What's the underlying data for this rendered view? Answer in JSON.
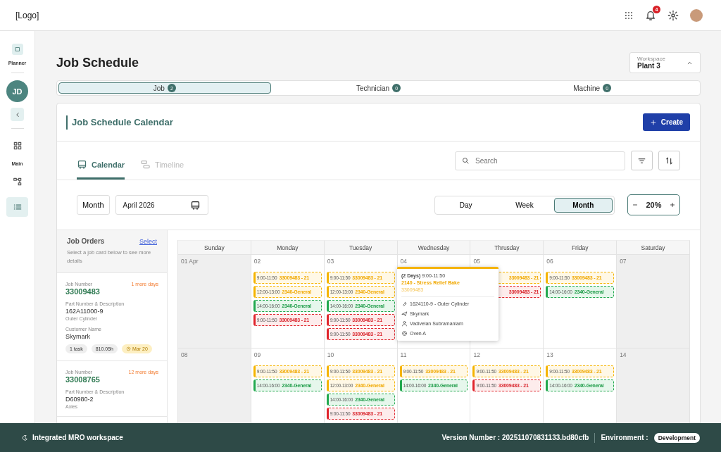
{
  "header": {
    "logo": "[Logo]",
    "notification_count": "4"
  },
  "sidebar": {
    "app_label": "Planner",
    "user_initials": "JD",
    "groups": [
      {
        "items": [
          {
            "kind": "dashboard",
            "selected": false
          }
        ]
      },
      {
        "label": "Main",
        "items": [
          {
            "kind": "hierarchy",
            "selected": false
          },
          {
            "kind": "list",
            "selected": true
          }
        ]
      }
    ]
  },
  "page": {
    "title": "Job Schedule",
    "workspace": {
      "label": "Workspace",
      "value": "Plant 3"
    },
    "view_tabs": [
      {
        "label": "Job",
        "count": "2",
        "selected": true
      },
      {
        "label": "Technician",
        "count": "0",
        "selected": false
      },
      {
        "label": "Machine",
        "count": "0",
        "selected": false
      }
    ]
  },
  "calendar_panel": {
    "title": "Job Schedule Calendar",
    "create_button": "Create",
    "mode_tabs": [
      {
        "label": "Calendar",
        "kind": "calendar",
        "selected": true
      },
      {
        "label": "Timeline",
        "kind": "timeline",
        "selected": false
      }
    ],
    "search": {
      "placeholder": "Search"
    },
    "period_type": "Month",
    "date_value": "April 2026",
    "range_tabs": [
      {
        "label": "Day",
        "selected": false
      },
      {
        "label": "Week",
        "selected": false
      },
      {
        "label": "Month",
        "selected": true
      }
    ],
    "zoom": "20%"
  },
  "job_orders": {
    "title": "Job Orders",
    "select_link": "Select",
    "hint": "Select a job card below to see more details",
    "cards": [
      {
        "job_number_label": "Job Number",
        "job_number": "33009483",
        "due": "1 more days",
        "part_label": "Part Number & Description",
        "part_number": "162A11000-9",
        "description": "Outer Cylinder",
        "customer_label": "Customer Name",
        "customer": "Skymark",
        "tasks": "1 task",
        "hours": "810.05h",
        "date": "Mar 20"
      },
      {
        "job_number_label": "Job Number",
        "job_number": "33008765",
        "due": "12 more days",
        "part_label": "Part Number & Description",
        "part_number": "D60980-2",
        "description": "Axles"
      }
    ]
  },
  "calendar": {
    "weekdays": [
      "Sunday",
      "Monday",
      "Tuesday",
      "Wednesday",
      "Thrusday",
      "Friday",
      "Saturday"
    ],
    "weeks": [
      {
        "days": [
          {
            "date": "01 Apr",
            "weekend": true
          },
          {
            "date": "02",
            "weekend": false,
            "events": [
              {
                "time": "9:00-11:50",
                "title": "33009483 - 21",
                "kind": "pending"
              },
              {
                "time": "12:00-13:00",
                "title": "2340-General",
                "kind": "pending"
              },
              {
                "time": "14:00-16:00",
                "title": "2340-General",
                "kind": "done"
              },
              {
                "time": "9:00-11:50",
                "title": "33009483 - 21",
                "kind": "late"
              }
            ]
          },
          {
            "date": "03",
            "weekend": false,
            "events": [
              {
                "time": "9:00-11:50",
                "title": "33009483 - 21",
                "kind": "pending"
              },
              {
                "time": "12:00-13:00",
                "title": "2340-General",
                "kind": "pending"
              },
              {
                "time": "14:00-16:00",
                "title": "2340-General",
                "kind": "done"
              },
              {
                "time": "9:00-11:50",
                "title": "33009483 - 21",
                "kind": "late"
              },
              {
                "time": "9:00-11:50",
                "title": "33009483 - 21",
                "kind": "late"
              }
            ]
          },
          {
            "date": "04",
            "weekend": false
          },
          {
            "date": "05",
            "weekend": false,
            "events": [
              {
                "title": "33009483 - 21",
                "kind": "pending"
              },
              {
                "title": "33009483 - 21",
                "kind": "late"
              }
            ]
          },
          {
            "date": "06",
            "weekend": false,
            "events": [
              {
                "time": "9:00-11:50",
                "title": "33009483 - 21",
                "kind": "pending"
              },
              {
                "time": "14:00-16:00",
                "title": "2340-General",
                "kind": "done"
              }
            ]
          },
          {
            "date": "07",
            "weekend": true
          }
        ]
      },
      {
        "days": [
          {
            "date": "08",
            "weekend": true
          },
          {
            "date": "09",
            "weekend": false,
            "events": [
              {
                "time": "9:00-11:50",
                "title": "33009483 - 21",
                "kind": "pending"
              },
              {
                "time": "14:00-16:00",
                "title": "2340-General",
                "kind": "done"
              }
            ]
          },
          {
            "date": "10",
            "weekend": false,
            "events": [
              {
                "time": "9:00-11:50",
                "title": "33009483 - 21",
                "kind": "pending"
              },
              {
                "time": "12:00-13:00",
                "title": "2340-General",
                "kind": "pending"
              },
              {
                "time": "14:00-16:00",
                "title": "2340-General",
                "kind": "done"
              },
              {
                "time": "9:00-11:50",
                "title": "33009483 - 21",
                "kind": "late"
              }
            ]
          },
          {
            "date": "11",
            "weekend": false,
            "events": [
              {
                "time": "9:00-11:50",
                "title": "33009483 - 21",
                "kind": "pending"
              },
              {
                "time": "14:00-16:00",
                "title": "2340-General",
                "kind": "done"
              }
            ]
          },
          {
            "date": "12",
            "weekend": false,
            "events": [
              {
                "time": "9:00-11:50",
                "title": "33009483 - 21",
                "kind": "pending"
              },
              {
                "time": "9:00-11:50",
                "title": "33009483 - 21",
                "kind": "late"
              }
            ]
          },
          {
            "date": "13",
            "weekend": false,
            "events": [
              {
                "time": "9:00-11:50",
                "title": "33009483 - 21",
                "kind": "pending"
              },
              {
                "time": "14:00-16:00",
                "title": "2340-General",
                "kind": "done"
              }
            ]
          },
          {
            "date": "14",
            "weekend": true
          }
        ]
      }
    ],
    "popup": {
      "duration": "(2 Days)",
      "time": "9:00-11:50",
      "title": "2140 - Stress Relief Bake",
      "job": "33009483",
      "kind": "pending",
      "details": [
        {
          "kind": "part",
          "text": "1624110-9 - Outer Cylinder"
        },
        {
          "kind": "customer",
          "text": "Skymark"
        },
        {
          "kind": "technician",
          "text": "Vadivelan Subramaniam"
        },
        {
          "kind": "machine",
          "text": "Oven A"
        }
      ]
    }
  },
  "footer": {
    "app_name": "Integrated MRO workspace",
    "version": "Version Number : 202511070831133.bd80cfb",
    "environment_label": "Environment :",
    "environment": "Development"
  }
}
